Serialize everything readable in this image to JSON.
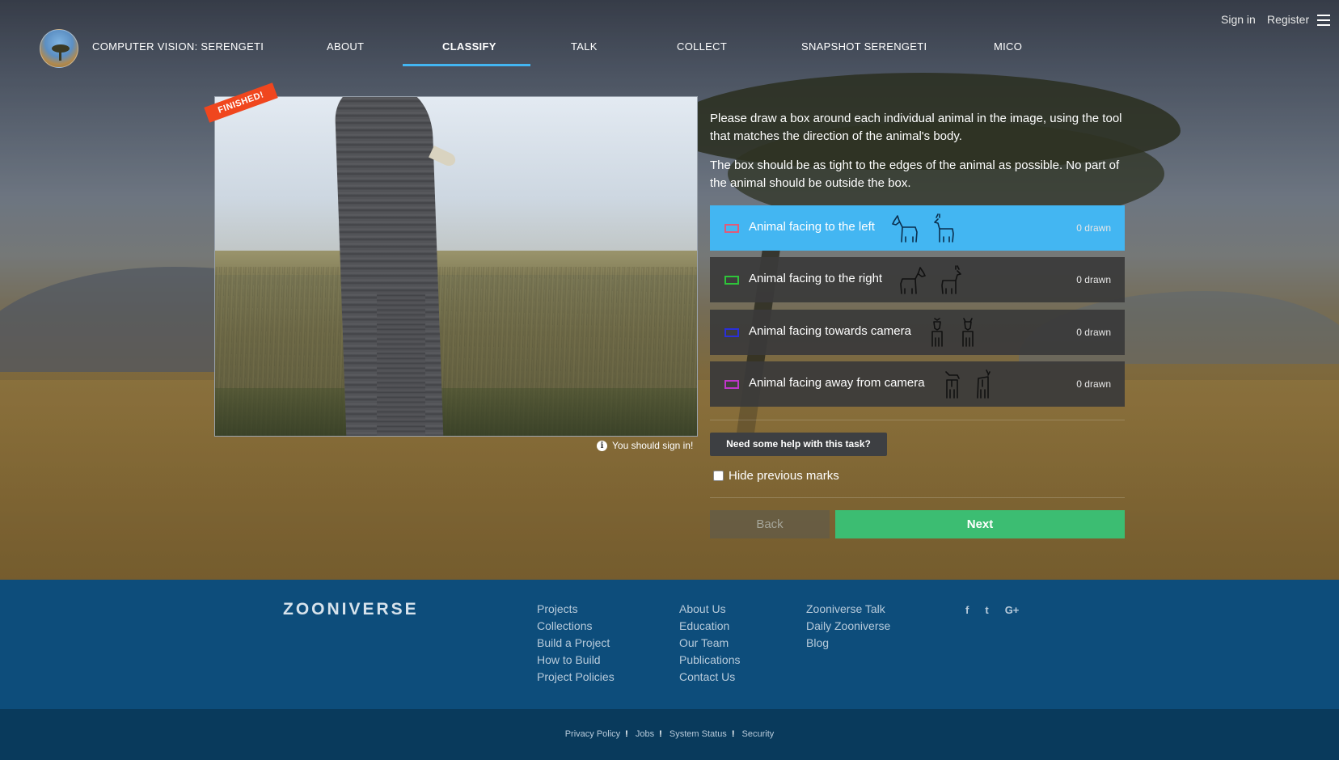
{
  "header": {
    "project_title": "COMPUTER VISION: SERENGETI",
    "nav": [
      {
        "label": "ABOUT"
      },
      {
        "label": "CLASSIFY"
      },
      {
        "label": "TALK"
      },
      {
        "label": "COLLECT"
      },
      {
        "label": "SNAPSHOT SERENGETI"
      },
      {
        "label": "MICO"
      }
    ],
    "active_tab": "CLASSIFY",
    "sign_in": "Sign in",
    "register": "Register"
  },
  "subject": {
    "ribbon": "FINISHED!",
    "signin_note": "You should sign in!"
  },
  "task": {
    "instructions": [
      "Please draw a box around each individual animal in the image, using the tool that matches the direction of the animal's body.",
      "The box should be as tight to the edges of the animal as possible. No part of the animal should be outside the box."
    ],
    "tools": [
      {
        "label": "Animal facing to the left",
        "count": "0 drawn",
        "color": "#e05a7a",
        "selected": true
      },
      {
        "label": "Animal facing to the right",
        "count": "0 drawn",
        "color": "#2ec43a",
        "selected": false
      },
      {
        "label": "Animal facing towards camera",
        "count": "0 drawn",
        "color": "#2a2fd9",
        "selected": false
      },
      {
        "label": "Animal facing away from camera",
        "count": "0 drawn",
        "color": "#c036c9",
        "selected": false
      }
    ],
    "help_button": "Need some help with this task?",
    "hide_marks_label": "Hide previous marks",
    "back_label": "Back",
    "next_label": "Next"
  },
  "footer": {
    "logo": "ZOONIVERSE",
    "col1": [
      "Projects",
      "Collections",
      "Build a Project",
      "How to Build",
      "Project Policies"
    ],
    "col2": [
      "About Us",
      "Education",
      "Our Team",
      "Publications",
      "Contact Us"
    ],
    "col3": [
      "Zooniverse Talk",
      "Daily Zooniverse",
      "Blog"
    ],
    "social": [
      {
        "icon": "facebook-icon",
        "glyph": "f"
      },
      {
        "icon": "twitter-icon",
        "glyph": "t"
      },
      {
        "icon": "google-plus-icon",
        "glyph": "G+"
      }
    ],
    "legal": [
      "Privacy Policy",
      "Jobs",
      "System Status",
      "Security"
    ]
  },
  "colors": {
    "accent": "#43b6f2",
    "next": "#3cbd72",
    "footer": "#0d4d7b",
    "ribbon": "#f0461e"
  }
}
